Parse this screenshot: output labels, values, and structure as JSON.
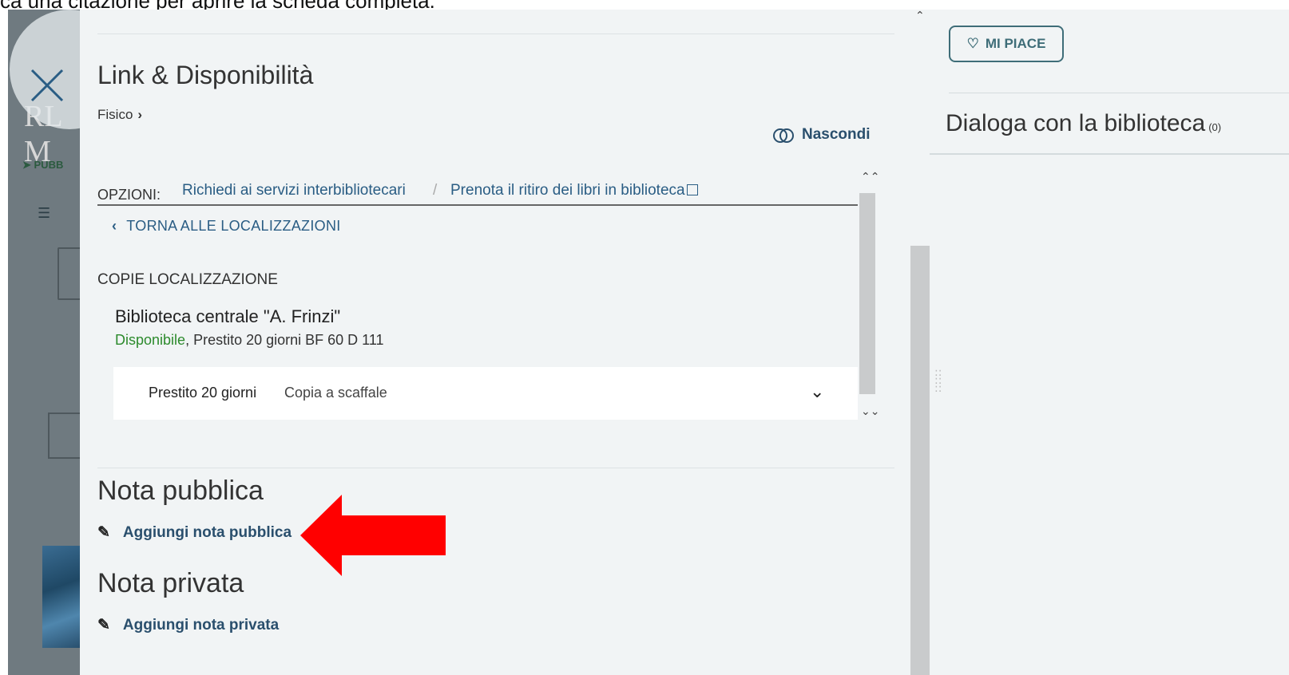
{
  "caption": "ca una citazione per aprire la scheda completa.",
  "background": {
    "logo_text": "RL M",
    "pub_label": "PUBB"
  },
  "panel": {
    "title": "Link & Disponibilità",
    "fisico": "Fisico",
    "hide_label": "Nascondi",
    "options_label": "OPZIONI:",
    "options": [
      {
        "label": "Richiedi ai servizi interbibliotecari"
      },
      {
        "label": "Prenota il ritiro dei libri in biblioteca"
      }
    ],
    "back_label": "TORNA ALLE LOCALIZZAZIONI",
    "copies_title": "COPIE LOCALIZZAZIONE",
    "library": {
      "name": "Biblioteca centrale \"A. Frinzi\"",
      "status": "Disponibile",
      "details": ", Prestito 20 giorni BF 60 D 111"
    },
    "copy_row": {
      "loan_type": "Prestito 20 giorni",
      "shelf": "Copia a scaffale"
    },
    "public_note": {
      "title": "Nota pubblica",
      "link": "Aggiungi nota pubblica"
    },
    "private_note": {
      "title": "Nota privata",
      "link": "Aggiungi nota privata"
    }
  },
  "right": {
    "like_label": "MI PIACE",
    "dialog_title": "Dialoga con la biblioteca",
    "dialog_count": "(0)"
  },
  "colors": {
    "link": "#2a5d84",
    "available": "#2c8a2c",
    "arrow": "#ff0000",
    "panel_bg": "#f1f4f5"
  }
}
